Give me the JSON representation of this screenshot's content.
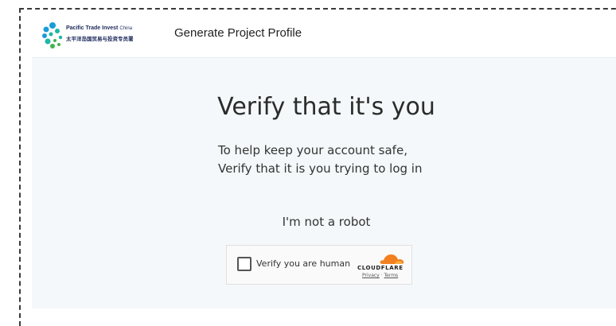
{
  "header": {
    "logo_text_en": "Pacific Trade Invest",
    "logo_text_en_suffix": "China",
    "logo_text_cn": "太平洋岛国贸易与投资专员署",
    "title": "Generate Project Profile"
  },
  "main": {
    "heading": "Verify that it's you",
    "subtitle_line1": "To help keep your account safe,",
    "subtitle_line2": "Verify that it is you trying to log in",
    "robot_label": "I'm not a robot"
  },
  "captcha": {
    "checkbox_label": "Verify you are human",
    "brand": "CLOUDFLARE",
    "privacy_link": "Privacy",
    "separator": "·",
    "terms_link": "Terms"
  },
  "colors": {
    "logo_blue": "#1a9bd7",
    "logo_teal": "#1fb6a7",
    "logo_green": "#40b34f",
    "cloudflare_orange": "#f38020",
    "page_bg": "#f4f8fa"
  }
}
